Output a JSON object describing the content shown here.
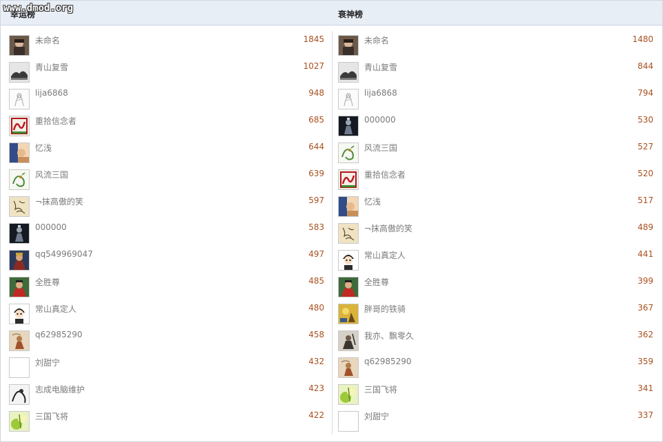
{
  "watermark": "www.dmod.org",
  "left": {
    "title": "幸运榜",
    "rows": [
      {
        "name": "未命名",
        "score": "1845",
        "avatar": "photo-girl-icon"
      },
      {
        "name": "青山复雪",
        "score": "1027",
        "avatar": "landscape-bw-icon"
      },
      {
        "name": "lija6868",
        "score": "948",
        "avatar": "sketch-figure-icon"
      },
      {
        "name": "重拾信念者",
        "score": "685",
        "avatar": "red-logo-icon"
      },
      {
        "name": "忆浅",
        "score": "644",
        "avatar": "photo-face-icon"
      },
      {
        "name": "风流三国",
        "score": "639",
        "avatar": "dragon-icon"
      },
      {
        "name": "¬抹高傲的笑",
        "score": "597",
        "avatar": "calligraphy-icon"
      },
      {
        "name": "000000",
        "score": "583",
        "avatar": "dark-warrior-icon"
      },
      {
        "name": "qq549969047",
        "score": "497",
        "avatar": "general-icon"
      },
      {
        "name": "全胜尊",
        "score": "485",
        "avatar": "red-warrior-icon"
      },
      {
        "name": "常山真定人",
        "score": "480",
        "avatar": "cartoon-boy-icon"
      },
      {
        "name": "q62985290",
        "score": "458",
        "avatar": "painting-icon"
      },
      {
        "name": "刘甜宁",
        "score": "432",
        "avatar": "blank-avatar-icon"
      },
      {
        "name": "志成电脑维护",
        "score": "423",
        "avatar": "ink-drawing-icon"
      },
      {
        "name": "三国飞将",
        "score": "422",
        "avatar": "green-glow-icon"
      }
    ]
  },
  "right": {
    "title": "衰神榜",
    "rows": [
      {
        "name": "未命名",
        "score": "1480",
        "avatar": "photo-girl-icon"
      },
      {
        "name": "青山复雪",
        "score": "844",
        "avatar": "landscape-bw-icon"
      },
      {
        "name": "lija6868",
        "score": "794",
        "avatar": "sketch-figure-icon"
      },
      {
        "name": "000000",
        "score": "530",
        "avatar": "dark-warrior-icon"
      },
      {
        "name": "风流三国",
        "score": "527",
        "avatar": "dragon-icon"
      },
      {
        "name": "重拾信念者",
        "score": "520",
        "avatar": "red-logo-icon"
      },
      {
        "name": "忆浅",
        "score": "517",
        "avatar": "photo-face-icon"
      },
      {
        "name": "¬抹高傲的笑",
        "score": "489",
        "avatar": "calligraphy-icon"
      },
      {
        "name": "常山真定人",
        "score": "441",
        "avatar": "cartoon-boy-icon"
      },
      {
        "name": "全胜尊",
        "score": "399",
        "avatar": "red-warrior-icon"
      },
      {
        "name": "胖哥的铁骑",
        "score": "367",
        "avatar": "yellow-art-icon"
      },
      {
        "name": "我亦、飘零久",
        "score": "362",
        "avatar": "warrior-sketch-icon"
      },
      {
        "name": "q62985290",
        "score": "359",
        "avatar": "painting-icon"
      },
      {
        "name": "三国飞将",
        "score": "341",
        "avatar": "green-glow-icon"
      },
      {
        "name": "刘甜宁",
        "score": "337",
        "avatar": "blank-avatar-icon"
      }
    ]
  },
  "colors": {
    "score": "#a8501e",
    "name": "#7a7a7a",
    "header_bg": "#e8eef6"
  }
}
